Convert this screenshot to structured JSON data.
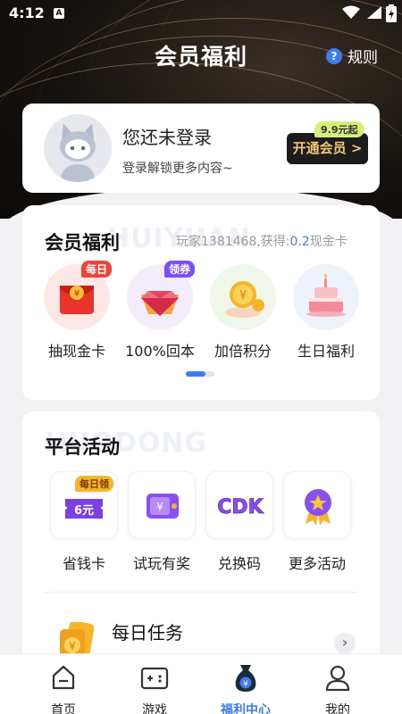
{
  "status_bar": {
    "time": "4:12",
    "notification_icon": "A"
  },
  "header": {
    "title": "会员福利",
    "rules_label": "规则",
    "rules_icon": "?"
  },
  "login_card": {
    "title": "您还未登录",
    "subtitle": "登录解锁更多内容~",
    "vip_button": "开通会员 >",
    "vip_badge": "9.9元起"
  },
  "benefits": {
    "title": "会员福利",
    "watermark": "HUIYUAN",
    "stat_prefix": "玩家1381468,获得:",
    "stat_value": "0.2",
    "stat_suffix": "现金卡",
    "items": [
      {
        "label": "抽现金卡",
        "tag": "每日",
        "icon": "red-envelope-icon"
      },
      {
        "label": "100%回本",
        "tag": "领券",
        "icon": "diamond-icon"
      },
      {
        "label": "加倍积分",
        "icon": "gold-coins-icon"
      },
      {
        "label": "生日福利",
        "icon": "birthday-cake-icon"
      }
    ]
  },
  "activities": {
    "title": "平台活动",
    "watermark": "HUODONG",
    "items": [
      {
        "label": "省钱卡",
        "tag": "每日领",
        "value_text": "6元",
        "icon": "coupon-icon"
      },
      {
        "label": "试玩有奖",
        "icon": "game-reward-icon"
      },
      {
        "label": "兑换码",
        "icon_text": "CDK",
        "icon": "cdk-icon"
      },
      {
        "label": "更多活动",
        "icon": "star-medal-icon"
      }
    ],
    "daily_task": {
      "title": "每日任务"
    }
  },
  "tabbar": {
    "tabs": [
      {
        "label": "首页",
        "icon": "home-icon"
      },
      {
        "label": "游戏",
        "icon": "gamepad-icon"
      },
      {
        "label": "福利中心",
        "icon": "money-bag-icon"
      },
      {
        "label": "我的",
        "icon": "user-icon"
      }
    ]
  },
  "colors": {
    "accent": "#3d7bf0",
    "vip_gold": "#f2c777",
    "badge_green": "#d4f07a"
  }
}
